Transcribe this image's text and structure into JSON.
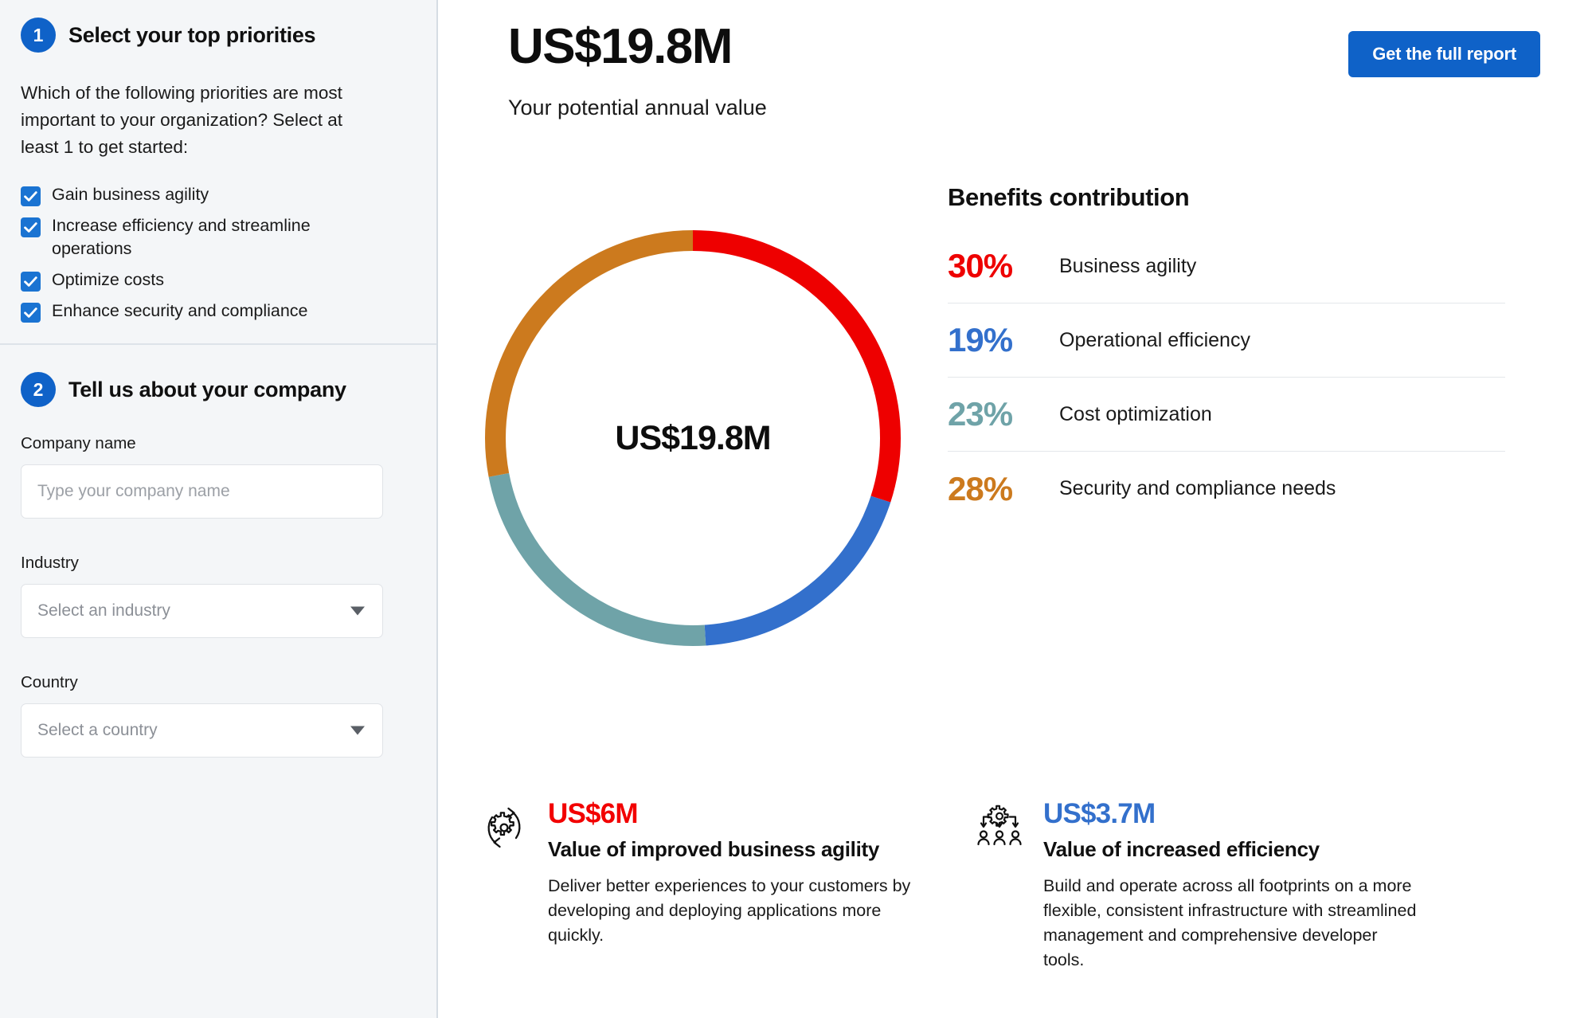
{
  "sidebar": {
    "step1": {
      "number": "1",
      "title": "Select your top priorities",
      "question": "Which of the following priorities are most important to your organization? Select at least 1 to get started:",
      "options": [
        {
          "label": "Gain business agility",
          "checked": true
        },
        {
          "label": "Increase efficiency and streamline operations",
          "checked": true
        },
        {
          "label": "Optimize costs",
          "checked": true
        },
        {
          "label": "Enhance security and compliance",
          "checked": true
        }
      ]
    },
    "step2": {
      "number": "2",
      "title": "Tell us about your company",
      "company_label": "Company name",
      "company_placeholder": "Type your company name",
      "company_value": "",
      "industry_label": "Industry",
      "industry_placeholder": "Select an industry",
      "country_label": "Country",
      "country_placeholder": "Select a country"
    }
  },
  "header": {
    "value": "US$19.8M",
    "subtitle": "Your potential annual value",
    "cta_label": "Get the full report"
  },
  "benefits": {
    "title": "Benefits contribution",
    "rows": [
      {
        "pct": "30%",
        "label": "Business agility",
        "color": "#EE0000"
      },
      {
        "pct": "19%",
        "label": "Operational efficiency",
        "color": "#3370CC"
      },
      {
        "pct": "23%",
        "label": "Cost optimization",
        "color": "#6FA3A8"
      },
      {
        "pct": "28%",
        "label": "Security and compliance needs",
        "color": "#CC7A1E"
      }
    ]
  },
  "cards": [
    {
      "icon": "gear-refresh-icon",
      "value": "US$6M",
      "value_color": "#F20000",
      "title": "Value of improved business agility",
      "desc": "Deliver better experiences to your customers by developing and deploying applications more quickly."
    },
    {
      "icon": "gear-to-people-icon",
      "value": "US$3.7M",
      "value_color": "#3370CC",
      "title": "Value of increased efficiency",
      "desc": "Build and operate across all footprints on a more flexible, consistent infrastructure with streamlined management and comprehensive developer tools."
    }
  ],
  "chart_data": {
    "type": "pie",
    "variant": "donut",
    "title": "Benefits contribution",
    "center_label": "US$19.8M",
    "total": "US$19.8M",
    "start_angle_deg": -90,
    "direction": "clockwise",
    "categories": [
      "Business agility",
      "Operational efficiency",
      "Cost optimization",
      "Security and compliance needs"
    ],
    "values": [
      30,
      19,
      23,
      28
    ],
    "unit": "%",
    "colors": [
      "#EE0000",
      "#3370CC",
      "#6FA3A8",
      "#CC7A1E"
    ],
    "legend": "right-panel",
    "grid": false
  }
}
